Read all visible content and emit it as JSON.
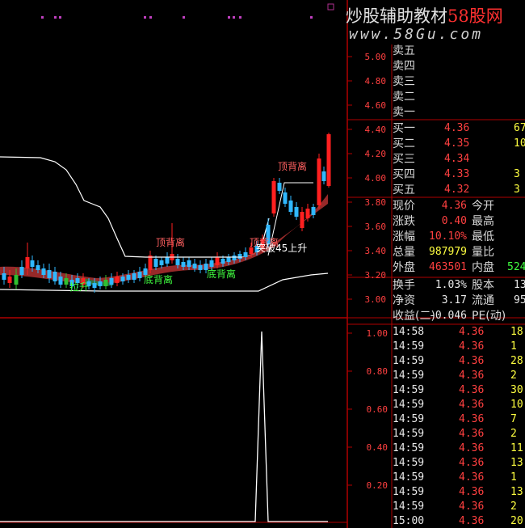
{
  "watermark": {
    "brand_prefix": "炒股辅助教材",
    "brand_red": "58股网",
    "url": "www.58Gu.com"
  },
  "top_axis": {
    "ticks": [
      "5.00",
      "4.80",
      "4.60",
      "4.40",
      "4.20",
      "4.00",
      "3.80",
      "3.60",
      "3.40",
      "3.20",
      "3.00"
    ]
  },
  "bottom_axis": {
    "ticks": [
      "1.00",
      "0.80",
      "0.60",
      "0.40",
      "0.20"
    ]
  },
  "annotations": [
    {
      "text": "顶背离",
      "color": "#ff6060"
    },
    {
      "text": "顶背离",
      "color": "#ff6060"
    },
    {
      "text": "顶背离",
      "color": "#ff6060"
    },
    {
      "text": "底背离",
      "color": "#40ff40"
    },
    {
      "text": "底背离",
      "color": "#40ff40"
    },
    {
      "text": "拉升",
      "color": "#40ff40"
    },
    {
      "text": "突破45上升",
      "color": "#ffffff"
    }
  ],
  "asks": [
    {
      "label": "卖五",
      "price": "",
      "vol": ""
    },
    {
      "label": "卖四",
      "price": "",
      "vol": ""
    },
    {
      "label": "卖三",
      "price": "",
      "vol": ""
    },
    {
      "label": "卖二",
      "price": "",
      "vol": ""
    },
    {
      "label": "卖一",
      "price": "",
      "vol": ""
    }
  ],
  "bids": [
    {
      "label": "买一",
      "price": "4.36",
      "vol": "67"
    },
    {
      "label": "买二",
      "price": "4.35",
      "vol": "10"
    },
    {
      "label": "买三",
      "price": "4.34",
      "vol": ""
    },
    {
      "label": "买四",
      "price": "4.33",
      "vol": "3"
    },
    {
      "label": "买五",
      "price": "4.32",
      "vol": "3"
    }
  ],
  "quote": [
    {
      "l1": "现价",
      "v1": "4.36",
      "c1": "red",
      "l2": "今开",
      "v2": ""
    },
    {
      "l1": "涨跌",
      "v1": "0.40",
      "c1": "red",
      "l2": "最高",
      "v2": ""
    },
    {
      "l1": "涨幅",
      "v1": "10.10%",
      "c1": "red",
      "l2": "最低",
      "v2": ""
    },
    {
      "l1": "总量",
      "v1": "987979",
      "c1": "yel",
      "l2": "量比",
      "v2": ""
    },
    {
      "l1": "外盘",
      "v1": "463501",
      "c1": "red",
      "l2": "内盘",
      "v2": "524"
    }
  ],
  "fundamentals": [
    {
      "l1": "换手",
      "v1": "1.03%",
      "l2": "股本",
      "v2": "13"
    },
    {
      "l1": "净资",
      "v1": "3.17",
      "l2": "流通",
      "v2": "95"
    },
    {
      "l1": "收益(二)",
      "v1": "-0.046",
      "l2": "PE(动)",
      "v2": ""
    }
  ],
  "ticks": [
    {
      "time": "14:58",
      "price": "4.36",
      "vol": "18"
    },
    {
      "time": "14:59",
      "price": "4.36",
      "vol": "1"
    },
    {
      "time": "14:59",
      "price": "4.36",
      "vol": "28"
    },
    {
      "time": "14:59",
      "price": "4.36",
      "vol": "2"
    },
    {
      "time": "14:59",
      "price": "4.36",
      "vol": "30"
    },
    {
      "time": "14:59",
      "price": "4.36",
      "vol": "10"
    },
    {
      "time": "14:59",
      "price": "4.36",
      "vol": "7"
    },
    {
      "time": "14:59",
      "price": "4.36",
      "vol": "2"
    },
    {
      "time": "14:59",
      "price": "4.36",
      "vol": "11"
    },
    {
      "time": "14:59",
      "price": "4.36",
      "vol": "13"
    },
    {
      "time": "14:59",
      "price": "4.36",
      "vol": "1"
    },
    {
      "time": "14:59",
      "price": "4.36",
      "vol": "13"
    },
    {
      "time": "14:59",
      "price": "4.36",
      "vol": "2"
    },
    {
      "time": "15:00",
      "price": "4.36",
      "vol": "20"
    }
  ]
}
